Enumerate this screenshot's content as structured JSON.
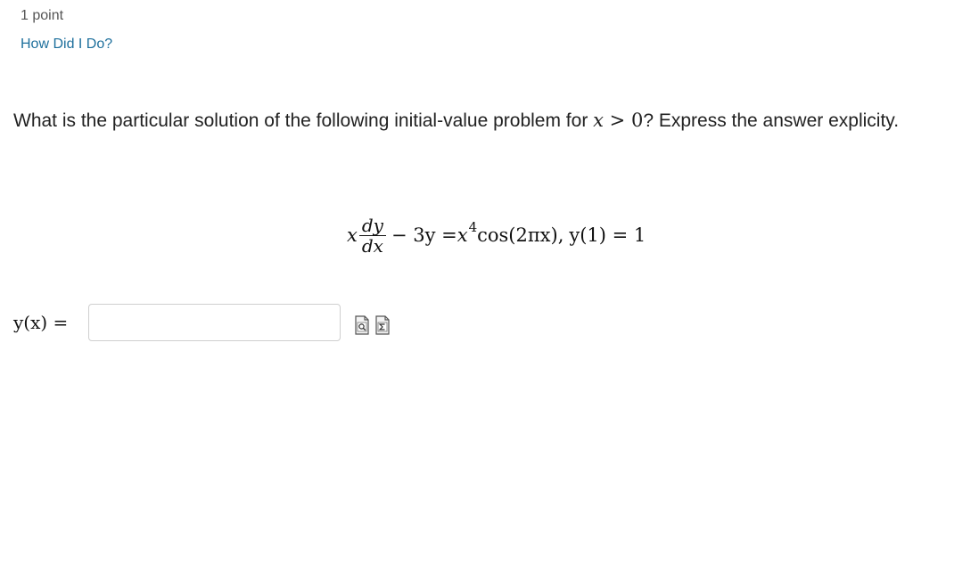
{
  "header": {
    "points": "1 point",
    "how_did_i_do": "How Did I Do?"
  },
  "question": {
    "text_before": "What is the particular solution of the following initial-value problem for ",
    "condition_var": "x",
    "condition_op": " > ",
    "condition_val": "0",
    "text_after": "? Express the answer explicity."
  },
  "equation": {
    "x_coef": "x",
    "numerator": "dy",
    "denominator": "dx",
    "minus_term": "− 3y = ",
    "x_base": "x",
    "exponent": "4",
    "cos_part": " cos(2πx),",
    "initial_condition": "y(1) = 1"
  },
  "answer": {
    "label": "y(x) =",
    "value": "",
    "placeholder": ""
  },
  "tools": {
    "preview_icon": "preview-document-icon",
    "equation_editor_icon": "sigma-equation-editor-icon"
  }
}
